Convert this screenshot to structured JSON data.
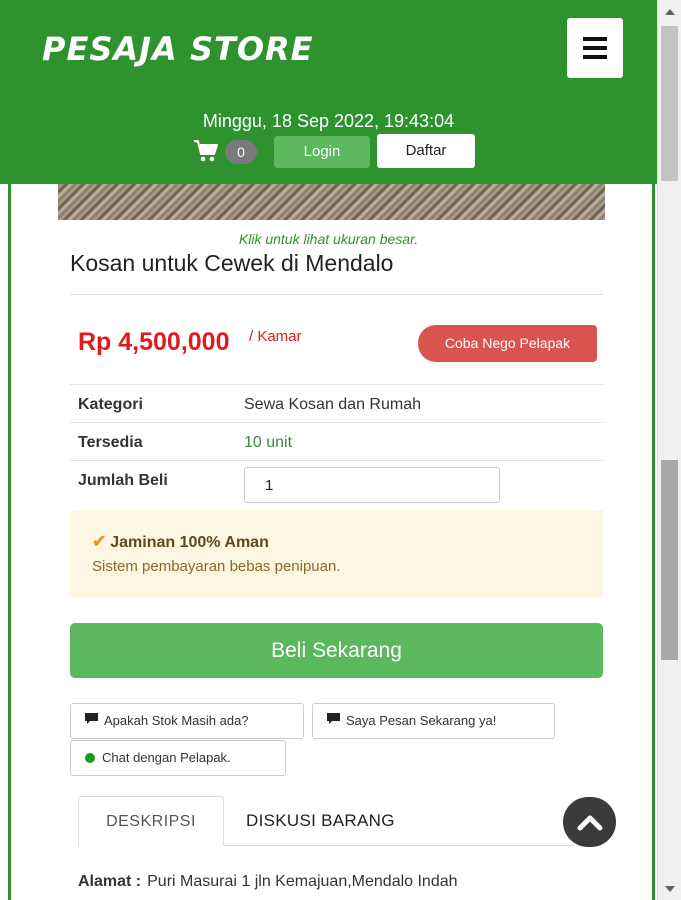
{
  "header": {
    "logo": "PESAJA STORE",
    "datetime": "Minggu, 18 Sep 2022, 19:43:04",
    "cart_count": "0",
    "login_label": "Login",
    "register_label": "Daftar",
    "brand_color": "#2e922e"
  },
  "product": {
    "image_caption": "Klik untuk lihat ukuran besar.",
    "title": "Kosan untuk Cewek di Mendalo",
    "price": "Rp 4,500,000",
    "unit": "/ Kamar",
    "nego_label": "Coba Nego Pelapak",
    "details": {
      "category_label": "Kategori",
      "category_value": "Sewa Kosan dan Rumah",
      "stock_label": "Tersedia",
      "stock_value": "10 unit",
      "qty_label": "Jumlah Beli",
      "qty_value": "1"
    },
    "guarantee": {
      "title": "Jaminan 100% Aman",
      "text": "Sistem pembayaran bebas penipuan."
    },
    "buy_label": "Beli Sekarang",
    "quick_messages": [
      "Apakah Stok Masih ada?",
      "Saya Pesan Sekarang ya!",
      "Chat dengan Pelapak."
    ],
    "tabs": [
      "DESKRIPSI",
      "DISKUSI BARANG"
    ],
    "address_label": "Alamat :",
    "address_value": "Puri Masurai 1 jln Kemajuan,Mendalo Indah"
  },
  "icons": {
    "menu": "hamburger-menu-icon",
    "cart": "shopping-cart-icon",
    "check": "checkmark-icon",
    "chat": "chat-bubble-icon",
    "online": "online-dot-icon",
    "to_top": "chevron-up-icon"
  }
}
